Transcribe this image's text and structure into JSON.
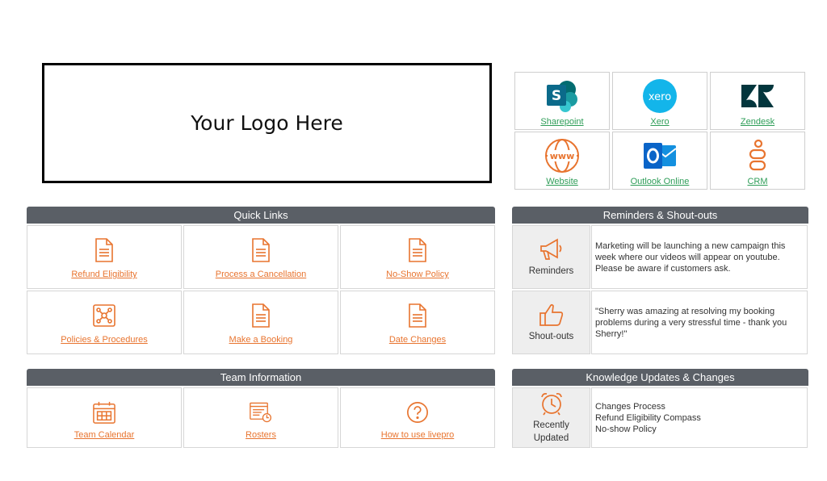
{
  "logo": {
    "text": "Your Logo Here"
  },
  "apps": [
    {
      "label": "Sharepoint",
      "icon": "sharepoint-icon"
    },
    {
      "label": "Xero",
      "icon": "xero-icon"
    },
    {
      "label": "Zendesk",
      "icon": "zendesk-icon"
    },
    {
      "label": "Website",
      "icon": "globe-www-icon"
    },
    {
      "label": "Outlook Online",
      "icon": "outlook-icon"
    },
    {
      "label": "CRM",
      "icon": "crm-icon"
    }
  ],
  "quick_links": {
    "title": "Quick Links",
    "items": [
      {
        "label": "Refund Eligibility",
        "icon": "document-icon"
      },
      {
        "label": "Process a Cancellation",
        "icon": "document-icon"
      },
      {
        "label": "No-Show Policy",
        "icon": "document-icon"
      },
      {
        "label": "Policies & Procedures",
        "icon": "network-icon"
      },
      {
        "label": "Make a Booking",
        "icon": "document-icon"
      },
      {
        "label": "Date Changes",
        "icon": "document-icon"
      }
    ]
  },
  "team_information": {
    "title": "Team Information",
    "items": [
      {
        "label": "Team Calendar",
        "icon": "calendar-icon"
      },
      {
        "label": "Rosters",
        "icon": "roster-icon"
      },
      {
        "label": "How to use livepro",
        "icon": "question-icon"
      }
    ]
  },
  "reminders": {
    "title": "Reminders & Shout-outs",
    "reminders_label": "Reminders",
    "reminders_text": "Marketing will be launching a new campaign this week where our videos will appear on youtube. Please be aware if customers ask.",
    "shoutouts_label": "Shout-outs",
    "shoutouts_text": "\"Sherry was amazing at resolving my booking problems during a very stressful time - thank you Sherry!\""
  },
  "knowledge": {
    "title": "Knowledge Updates & Changes",
    "label_line1": "Recently",
    "label_line2": "Updated",
    "items": [
      "Changes Process",
      "Refund Eligibility Compass",
      "No-show Policy"
    ]
  },
  "colors": {
    "accent_orange": "#e8742f",
    "link_green": "#2e9d58",
    "header_gray": "#5a5f66",
    "sharepoint": "#0f6cbd",
    "xero": "#13b5ea",
    "zendesk": "#03363d",
    "outlook": "#0a64c8"
  }
}
